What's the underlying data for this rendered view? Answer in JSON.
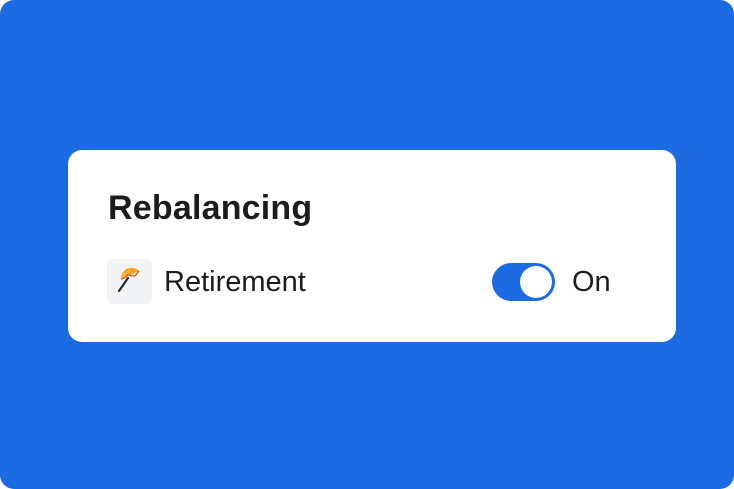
{
  "card": {
    "title": "Rebalancing",
    "account": {
      "icon": "umbrella-icon",
      "label": "Retirement"
    },
    "toggle": {
      "checked": true,
      "state_label": "On"
    }
  },
  "colors": {
    "background": "#1d6be3",
    "card": "#ffffff",
    "toggle_on": "#1d6be3",
    "icon_tile": "#f2f3f5",
    "text": "#1c1c1c"
  }
}
